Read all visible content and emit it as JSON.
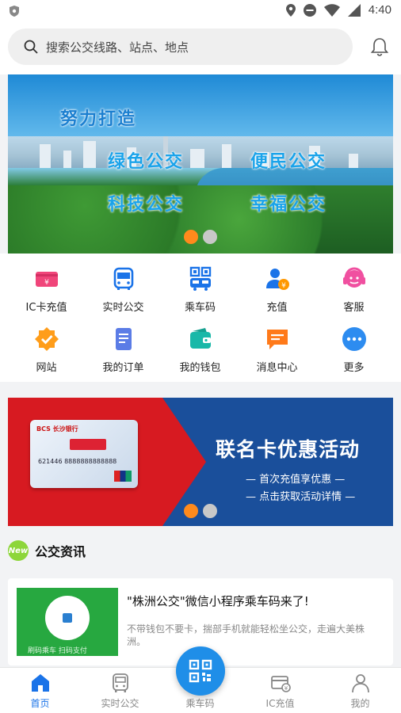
{
  "status_bar": {
    "time": "4:40"
  },
  "search": {
    "placeholder": "搜索公交线路、站点、地点"
  },
  "banner": {
    "line1": "努力打造",
    "line2": "绿色公交",
    "line3": "便民公交",
    "line4": "科技公交",
    "line5": "幸福公交"
  },
  "quick_grid": [
    {
      "label": "IC卡充值",
      "icon": "ic-card-icon",
      "color": "#f0457a"
    },
    {
      "label": "实时公交",
      "icon": "bus-icon",
      "color": "#1a73e8"
    },
    {
      "label": "乘车码",
      "icon": "qr-bus-icon",
      "color": "#1a73e8"
    },
    {
      "label": "充值",
      "icon": "user-yuan-icon",
      "color": "#ff9800"
    },
    {
      "label": "客服",
      "icon": "headset-icon",
      "color": "#f050a0"
    },
    {
      "label": "网站",
      "icon": "badge-check-icon",
      "color": "#ff9d1a"
    },
    {
      "label": "我的订单",
      "icon": "order-icon",
      "color": "#5b7ce6"
    },
    {
      "label": "我的钱包",
      "icon": "wallet-icon",
      "color": "#19b8a8"
    },
    {
      "label": "消息中心",
      "icon": "message-icon",
      "color": "#ff7a1a"
    },
    {
      "label": "更多",
      "icon": "more-icon",
      "color": "#2d8cf0"
    }
  ],
  "promo": {
    "headline": "联名卡优惠活动",
    "sub1": "— 首次充值享优惠 —",
    "sub2": "— 点击获取活动详情 —",
    "card_bank": "BCS 长沙银行",
    "card_number": "621446 8888888888888"
  },
  "news": {
    "badge": "New",
    "section_title": "公交资讯",
    "items": [
      {
        "title": "\"株洲公交\"微信小程序乘车码来了!",
        "desc": "不带钱包不要卡，揣部手机就能轻松坐公交，走遍大美株洲。",
        "thumb_caption": "刷码乘车 扫码支付"
      }
    ]
  },
  "tabbar": [
    {
      "label": "首页",
      "icon": "home-icon",
      "active": true
    },
    {
      "label": "实时公交",
      "icon": "bus-tab-icon",
      "active": false
    },
    {
      "label": "乘车码",
      "icon": "qr-code-icon",
      "active": false
    },
    {
      "label": "IC充值",
      "icon": "card-tab-icon",
      "active": false
    },
    {
      "label": "我的",
      "icon": "profile-icon",
      "active": false
    }
  ],
  "colors": {
    "accent": "#1a73e8",
    "orange": "#ff8a1c",
    "promo_red": "#d71a21",
    "promo_blue": "#1a4f9b"
  }
}
